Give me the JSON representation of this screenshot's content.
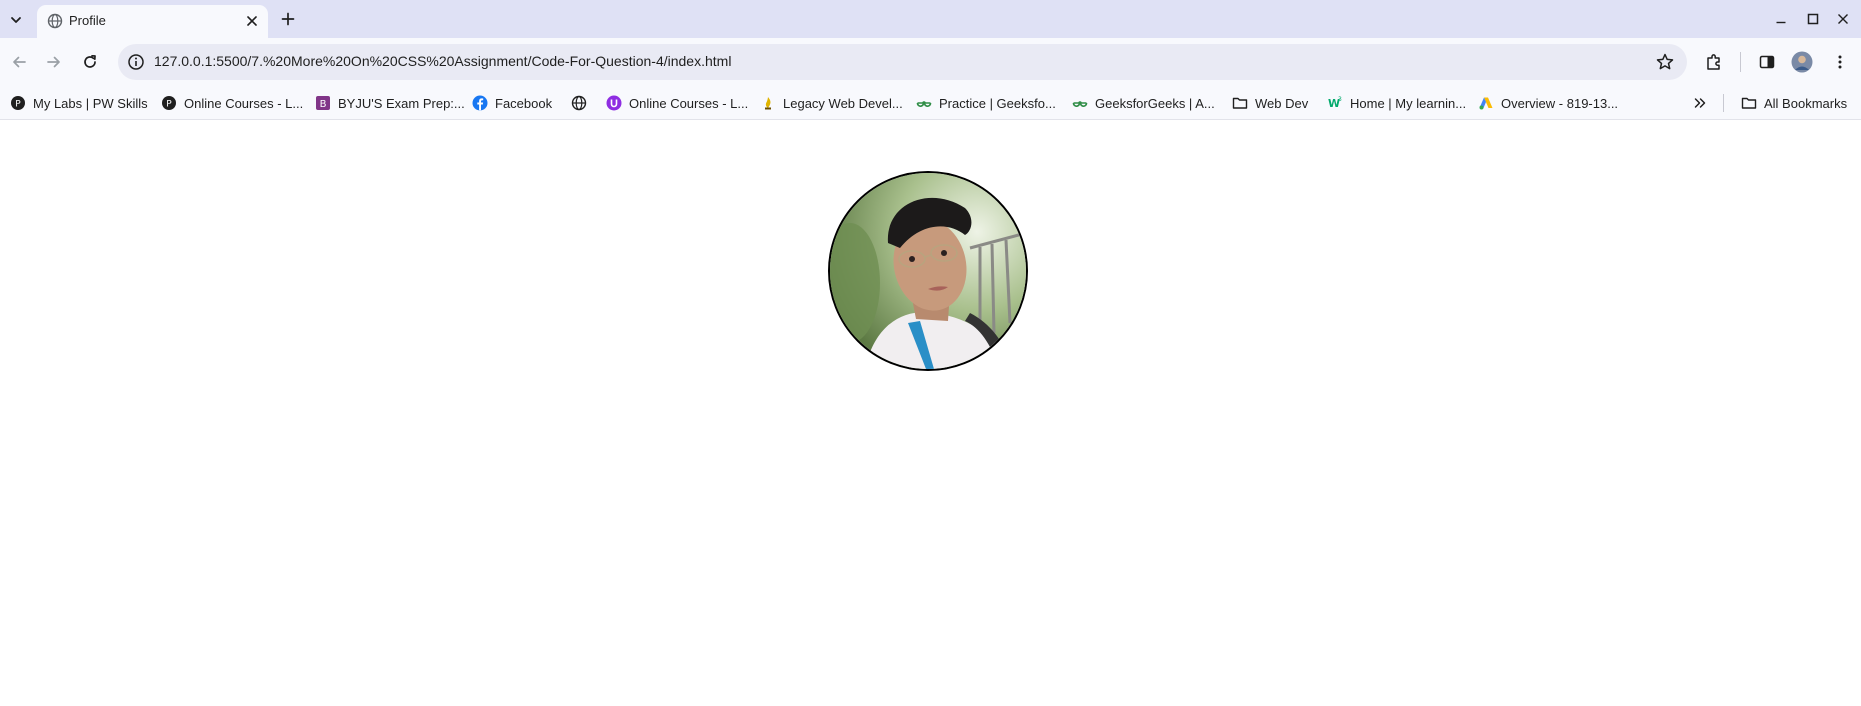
{
  "browser": {
    "tab": {
      "title": "Profile"
    },
    "address_bar": {
      "url": "127.0.0.1:5500/7.%20More%20On%20CSS%20Assignment/Code-For-Question-4/index.html"
    },
    "bookmarks": [
      {
        "label": "My Labs | PW Skills",
        "icon": "pw-skills-icon"
      },
      {
        "label": "Online Courses - L...",
        "icon": "pw-skills-icon"
      },
      {
        "label": "BYJU'S Exam Prep:...",
        "icon": "byjus-icon"
      },
      {
        "label": "Facebook",
        "icon": "facebook-icon"
      },
      {
        "label": "",
        "icon": "globe-icon"
      },
      {
        "label": "Online Courses - L...",
        "icon": "purple-course-icon"
      },
      {
        "label": "Legacy Web Devel...",
        "icon": "freecodecamp-icon"
      },
      {
        "label": "Practice | Geeksfo...",
        "icon": "geeksforgeeks-icon"
      },
      {
        "label": "GeeksforGeeks | A...",
        "icon": "geeksforgeeks-icon"
      },
      {
        "label": "Web Dev",
        "icon": "folder-icon"
      },
      {
        "label": "Home | My learnin...",
        "icon": "w3schools-icon"
      },
      {
        "label": "Overview - 819-13...",
        "icon": "google-ads-icon"
      }
    ],
    "all_bookmarks_label": "All Bookmarks"
  },
  "page": {
    "profile_image_alt": "Profile photo"
  },
  "colors": {
    "tabstrip": "#dfe1f5",
    "toolbar": "#f8f9fd",
    "omnibox": "#e9eaf4",
    "avatar_border": "#000000"
  }
}
